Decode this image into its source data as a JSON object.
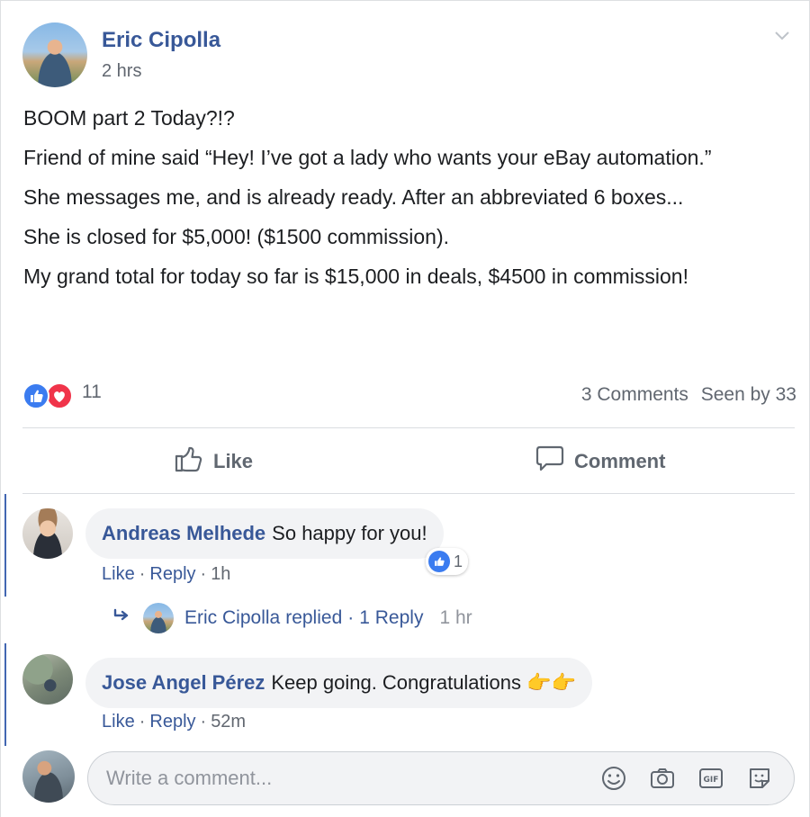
{
  "post": {
    "author": "Eric Cipolla",
    "time": "2 hrs",
    "paragraphs": [
      "BOOM part 2 Today?!?",
      "Friend of mine said “Hey! I’ve got a lady who wants your eBay automation.”",
      "She messages me, and is already ready. After an abbreviated 6 boxes...",
      "She is closed for $5,000! ($1500 commission).",
      "My grand total for today so far is $15,000 in deals, $4500 in commission!"
    ]
  },
  "reactions": {
    "count": "11",
    "comments": "3 Comments",
    "seen": "Seen by 33"
  },
  "actions": {
    "like": "Like",
    "comment": "Comment"
  },
  "comments": [
    {
      "name": "Andreas Melhede",
      "text": "So happy for you!",
      "like": "Like",
      "reply": "Reply",
      "time": "1h",
      "reaction_count": "1",
      "replies": {
        "author": "Eric Cipolla",
        "replied": "replied",
        "count": "1 Reply",
        "time": "1 hr"
      }
    },
    {
      "name": "Jose Angel Pérez",
      "text": "Keep going. Congratulations 👉👉",
      "like": "Like",
      "reply": "Reply",
      "time": "52m"
    }
  ],
  "write": {
    "placeholder": "Write a comment..."
  },
  "colors": {
    "link": "#385898",
    "like_blue": "#3b7cf0",
    "love_red": "#f0344a",
    "thread_bar": "#4267b2"
  }
}
